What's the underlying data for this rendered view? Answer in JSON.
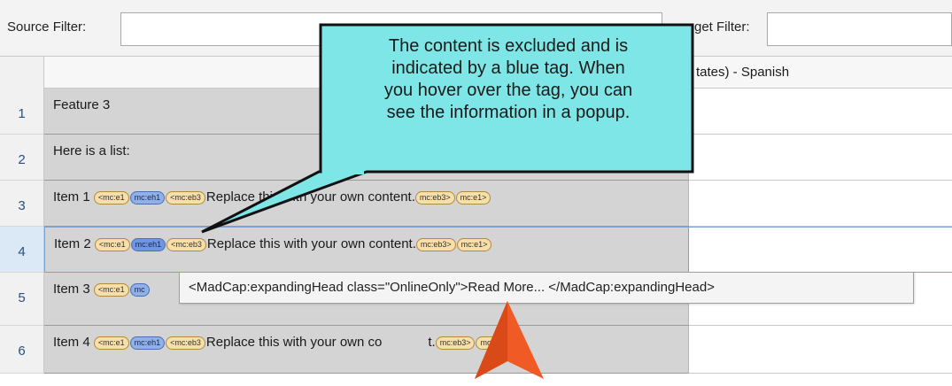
{
  "filters": {
    "source_label": "Source Filter:",
    "source_value": "",
    "target_label": "get Filter:",
    "target_value": ""
  },
  "columns": {
    "source_header": "",
    "target_header": "tates) - Spanish"
  },
  "rows": [
    {
      "num": "1",
      "text": "Feature 3"
    },
    {
      "num": "2",
      "text": "Here is a list:"
    },
    {
      "num": "3",
      "prefix": "Item 1",
      "tags_before": [
        "<mc:e1",
        "mc:eh1",
        "<mc:eb3"
      ],
      "text": "Replace this with your own content.",
      "tags_after": [
        "mc:eb3>",
        "mc:e1>"
      ]
    },
    {
      "num": "4",
      "prefix": "Item 2",
      "tags_before": [
        "<mc:e1",
        "mc:eh1",
        "<mc:eb3"
      ],
      "text": "Replace this with your own content.",
      "tags_after": [
        "mc:eb3>",
        "mc:e1>"
      ]
    },
    {
      "num": "5",
      "prefix": "Item 3",
      "tags_before": [
        "<mc:e1",
        "mc"
      ],
      "text": "",
      "tags_after": []
    },
    {
      "num": "6",
      "prefix": "Item 4",
      "tags_before": [
        "<mc:e1",
        "mc:eh1",
        "<mc:eb3"
      ],
      "text": "Replace this with your own co",
      "text_tail": "t.",
      "tags_after": [
        "mc:eb3>",
        "mc:e1>"
      ]
    }
  ],
  "tooltip": {
    "text": "<MadCap:expandingHead class=\"OnlineOnly\">Read More... </MadCap:expandingHead>"
  },
  "callout": {
    "line1": "The content is excluded and is",
    "line2": "indicated by a blue tag. When",
    "line3": "you hover over the tag, you can",
    "line4": "see the information in a popup.",
    "fill": "#7ee6e6",
    "border": "#111111"
  },
  "colors": {
    "source_cell_bg": "#d4d4d4",
    "orange_tag": "#f7dfa9",
    "blue_tag": "#8fb0e8",
    "arrow": "#f05a24"
  }
}
